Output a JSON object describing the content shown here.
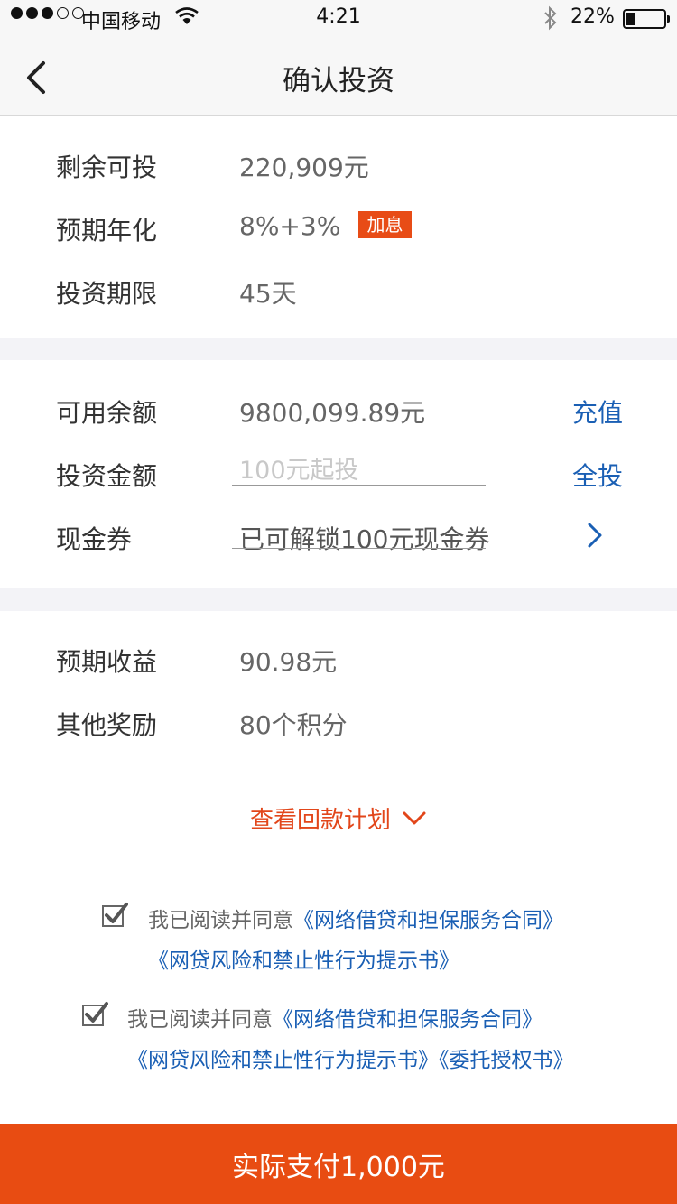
{
  "status_bar": {
    "carrier": "中国移动",
    "time": "4:21",
    "battery": "22%",
    "battery_level": 0.22
  },
  "nav": {
    "title": "确认投资"
  },
  "info": {
    "remaining_label": "剩余可投",
    "remaining_value": "220,909元",
    "rate_label": "预期年化",
    "rate_value": "8%+3%",
    "rate_badge": "加息",
    "term_label": "投资期限",
    "term_value": "45天"
  },
  "invest": {
    "balance_label": "可用余额",
    "balance_value": "9800,099.89元",
    "recharge_label": "充值",
    "amount_label": "投资金额",
    "amount_placeholder": "100元起投",
    "all_label": "全投",
    "coupon_label": "现金券",
    "coupon_value": "已可解锁100元现金券"
  },
  "result": {
    "expected_label": "预期收益",
    "expected_value": "90.98元",
    "reward_label": "其他奖励",
    "reward_value": "80个积分",
    "plan_label": "查看回款计划"
  },
  "agreements": [
    {
      "prefix": "我已阅读并同意",
      "link1": "《网络借贷和担保服务合同》",
      "link2": "《网贷风险和禁止性行为提示书》",
      "checked": true
    },
    {
      "prefix": "我已阅读并同意",
      "link1": "《网络借贷和担保服务合同》",
      "link2": "《网贷风险和禁止性行为提示书》",
      "link3": "《委托授权书》",
      "checked": true
    }
  ],
  "pay_button": "实际支付1,000元",
  "colors": {
    "accent": "#e84c12",
    "link": "#1a5fb4",
    "plan": "#e2461a",
    "separator": "#f3f3f7"
  },
  "icons": [
    "signal-dots-icon",
    "wifi-icon",
    "bluetooth-icon",
    "battery-icon",
    "back-chevron-icon",
    "chevron-right-icon",
    "chevron-down-icon",
    "checkbox-checked-icon"
  ]
}
